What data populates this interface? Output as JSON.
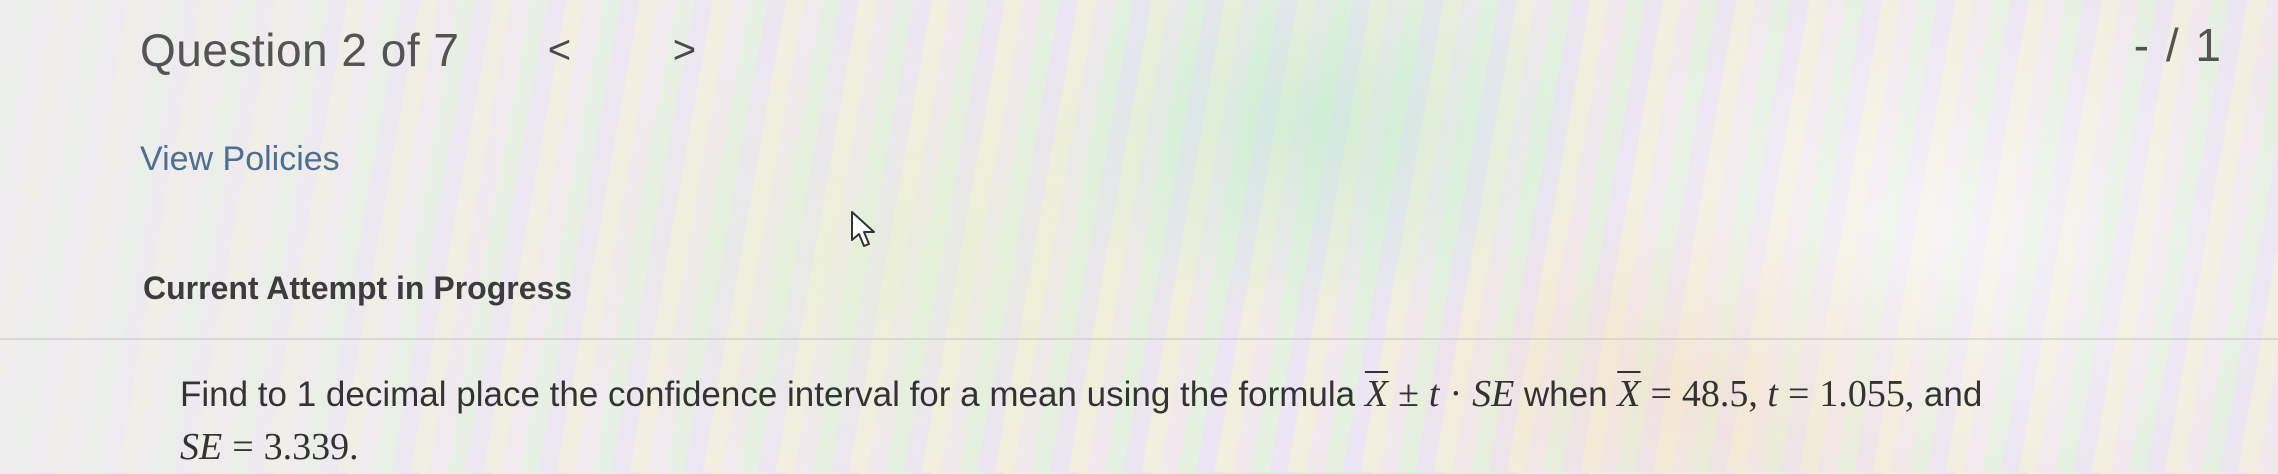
{
  "header": {
    "question_counter": "Question 2 of 7",
    "prev_arrow": "<",
    "next_arrow": ">",
    "score": "- / 1"
  },
  "links": {
    "view_policies": "View Policies"
  },
  "attempt": {
    "heading": "Current Attempt in Progress"
  },
  "question": {
    "prompt": "Find to 1 decimal place the confidence interval for a mean using the formula",
    "formula": {
      "xbar": "X",
      "pm": "±",
      "t": "t",
      "dot": "·",
      "se": "SE"
    },
    "when": "when",
    "xbar_eq": "X",
    "eq": "=",
    "xbar_value": "48.5,",
    "t_var": "t",
    "t_value": "1.055,",
    "and": "and",
    "se_var": "SE",
    "se_value": "3.339."
  },
  "icons": {
    "cursor": "mouse-pointer-icon"
  }
}
